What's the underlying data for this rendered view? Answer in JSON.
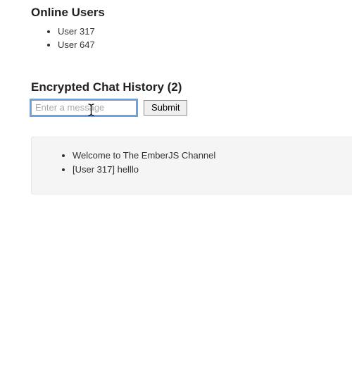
{
  "users_section": {
    "heading": "Online Users",
    "items": [
      "User 317",
      "User 647"
    ]
  },
  "history_section": {
    "heading": "Encrypted Chat History (2)",
    "input_placeholder": "Enter a message",
    "submit_label": "Submit",
    "messages": [
      "Welcome to The EmberJS Channel",
      "[User 317] helllo"
    ]
  }
}
